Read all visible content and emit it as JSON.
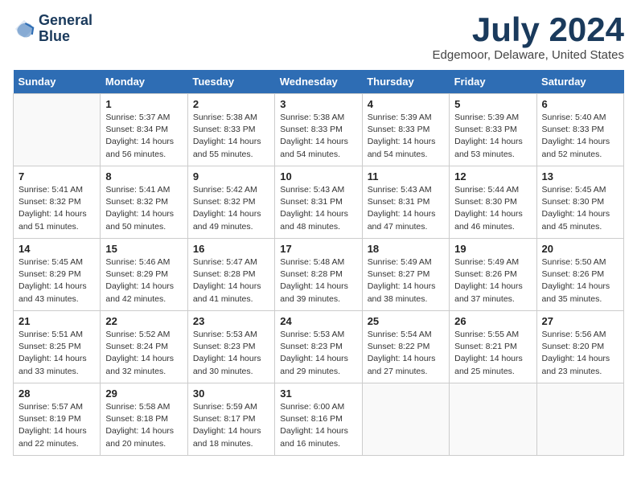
{
  "logo": {
    "line1": "General",
    "line2": "Blue"
  },
  "title": "July 2024",
  "subtitle": "Edgemoor, Delaware, United States",
  "weekdays": [
    "Sunday",
    "Monday",
    "Tuesday",
    "Wednesday",
    "Thursday",
    "Friday",
    "Saturday"
  ],
  "weeks": [
    [
      {
        "day": "",
        "info": ""
      },
      {
        "day": "1",
        "info": "Sunrise: 5:37 AM\nSunset: 8:34 PM\nDaylight: 14 hours\nand 56 minutes."
      },
      {
        "day": "2",
        "info": "Sunrise: 5:38 AM\nSunset: 8:33 PM\nDaylight: 14 hours\nand 55 minutes."
      },
      {
        "day": "3",
        "info": "Sunrise: 5:38 AM\nSunset: 8:33 PM\nDaylight: 14 hours\nand 54 minutes."
      },
      {
        "day": "4",
        "info": "Sunrise: 5:39 AM\nSunset: 8:33 PM\nDaylight: 14 hours\nand 54 minutes."
      },
      {
        "day": "5",
        "info": "Sunrise: 5:39 AM\nSunset: 8:33 PM\nDaylight: 14 hours\nand 53 minutes."
      },
      {
        "day": "6",
        "info": "Sunrise: 5:40 AM\nSunset: 8:33 PM\nDaylight: 14 hours\nand 52 minutes."
      }
    ],
    [
      {
        "day": "7",
        "info": "Sunrise: 5:41 AM\nSunset: 8:32 PM\nDaylight: 14 hours\nand 51 minutes."
      },
      {
        "day": "8",
        "info": "Sunrise: 5:41 AM\nSunset: 8:32 PM\nDaylight: 14 hours\nand 50 minutes."
      },
      {
        "day": "9",
        "info": "Sunrise: 5:42 AM\nSunset: 8:32 PM\nDaylight: 14 hours\nand 49 minutes."
      },
      {
        "day": "10",
        "info": "Sunrise: 5:43 AM\nSunset: 8:31 PM\nDaylight: 14 hours\nand 48 minutes."
      },
      {
        "day": "11",
        "info": "Sunrise: 5:43 AM\nSunset: 8:31 PM\nDaylight: 14 hours\nand 47 minutes."
      },
      {
        "day": "12",
        "info": "Sunrise: 5:44 AM\nSunset: 8:30 PM\nDaylight: 14 hours\nand 46 minutes."
      },
      {
        "day": "13",
        "info": "Sunrise: 5:45 AM\nSunset: 8:30 PM\nDaylight: 14 hours\nand 45 minutes."
      }
    ],
    [
      {
        "day": "14",
        "info": "Sunrise: 5:45 AM\nSunset: 8:29 PM\nDaylight: 14 hours\nand 43 minutes."
      },
      {
        "day": "15",
        "info": "Sunrise: 5:46 AM\nSunset: 8:29 PM\nDaylight: 14 hours\nand 42 minutes."
      },
      {
        "day": "16",
        "info": "Sunrise: 5:47 AM\nSunset: 8:28 PM\nDaylight: 14 hours\nand 41 minutes."
      },
      {
        "day": "17",
        "info": "Sunrise: 5:48 AM\nSunset: 8:28 PM\nDaylight: 14 hours\nand 39 minutes."
      },
      {
        "day": "18",
        "info": "Sunrise: 5:49 AM\nSunset: 8:27 PM\nDaylight: 14 hours\nand 38 minutes."
      },
      {
        "day": "19",
        "info": "Sunrise: 5:49 AM\nSunset: 8:26 PM\nDaylight: 14 hours\nand 37 minutes."
      },
      {
        "day": "20",
        "info": "Sunrise: 5:50 AM\nSunset: 8:26 PM\nDaylight: 14 hours\nand 35 minutes."
      }
    ],
    [
      {
        "day": "21",
        "info": "Sunrise: 5:51 AM\nSunset: 8:25 PM\nDaylight: 14 hours\nand 33 minutes."
      },
      {
        "day": "22",
        "info": "Sunrise: 5:52 AM\nSunset: 8:24 PM\nDaylight: 14 hours\nand 32 minutes."
      },
      {
        "day": "23",
        "info": "Sunrise: 5:53 AM\nSunset: 8:23 PM\nDaylight: 14 hours\nand 30 minutes."
      },
      {
        "day": "24",
        "info": "Sunrise: 5:53 AM\nSunset: 8:23 PM\nDaylight: 14 hours\nand 29 minutes."
      },
      {
        "day": "25",
        "info": "Sunrise: 5:54 AM\nSunset: 8:22 PM\nDaylight: 14 hours\nand 27 minutes."
      },
      {
        "day": "26",
        "info": "Sunrise: 5:55 AM\nSunset: 8:21 PM\nDaylight: 14 hours\nand 25 minutes."
      },
      {
        "day": "27",
        "info": "Sunrise: 5:56 AM\nSunset: 8:20 PM\nDaylight: 14 hours\nand 23 minutes."
      }
    ],
    [
      {
        "day": "28",
        "info": "Sunrise: 5:57 AM\nSunset: 8:19 PM\nDaylight: 14 hours\nand 22 minutes."
      },
      {
        "day": "29",
        "info": "Sunrise: 5:58 AM\nSunset: 8:18 PM\nDaylight: 14 hours\nand 20 minutes."
      },
      {
        "day": "30",
        "info": "Sunrise: 5:59 AM\nSunset: 8:17 PM\nDaylight: 14 hours\nand 18 minutes."
      },
      {
        "day": "31",
        "info": "Sunrise: 6:00 AM\nSunset: 8:16 PM\nDaylight: 14 hours\nand 16 minutes."
      },
      {
        "day": "",
        "info": ""
      },
      {
        "day": "",
        "info": ""
      },
      {
        "day": "",
        "info": ""
      }
    ]
  ]
}
